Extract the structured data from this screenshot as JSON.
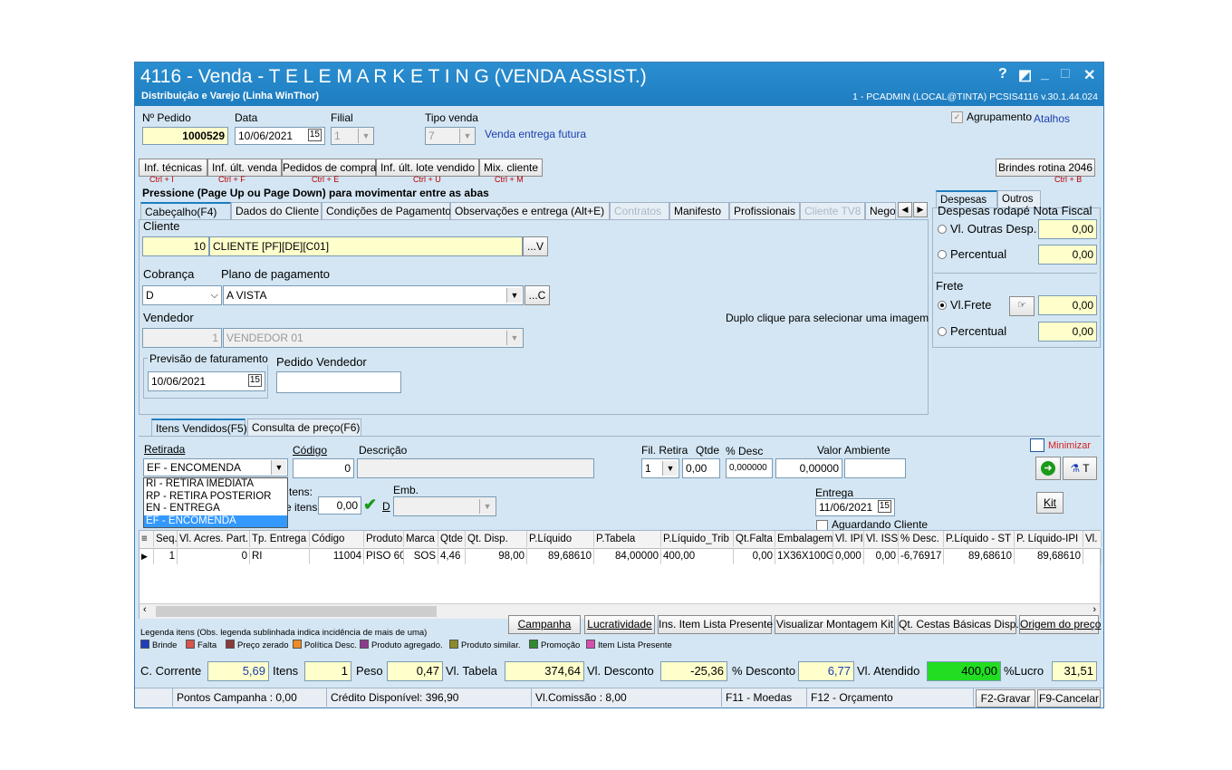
{
  "window": {
    "title": "4116 - Venda - T E L E M A R K E T I N G  (VENDA ASSIST.)",
    "subtitle": "Distribuição e Varejo (Linha WinThor)",
    "user_info": "1 - PCADMIN (LOCAL@TINTA)  PCSIS4116  v.30.1.44.024",
    "controls": {
      "help": "?",
      "restore": "◩",
      "minimize": "_",
      "maximize": "□",
      "close": "✕"
    }
  },
  "header": {
    "pedido_label": "Nº Pedido",
    "pedido_value": "1000529",
    "data_label": "Data",
    "data_value": "10/06/2021",
    "filial_label": "Filial",
    "filial_value": "1",
    "tipo_venda_label": "Tipo venda",
    "tipo_venda_value": "7",
    "tipo_venda_desc": "Venda entrega futura",
    "agrupamento_label": "Agrupamento",
    "atalhos_label": "Atalhos"
  },
  "toolbar": {
    "buttons": [
      {
        "label": "Inf. técnicas",
        "shortcut": "Ctrl + I"
      },
      {
        "label": "Inf. últ. venda",
        "shortcut": "Ctrl + F"
      },
      {
        "label": "Pedidos de compra",
        "shortcut": "Ctrl + E"
      },
      {
        "label": "Inf. últ. lote vendido",
        "shortcut": "Ctrl + U"
      },
      {
        "label": "Mix. cliente",
        "shortcut": "Ctrl + M"
      }
    ],
    "brindes": {
      "label": "Brindes rotina 2046",
      "shortcut": "Ctrl + B"
    }
  },
  "hint": "Pressione (Page Up ou Page Down) para movimentar entre as abas",
  "tabs": [
    {
      "label": "Cabeçalho(F4)"
    },
    {
      "label": "Dados do Cliente"
    },
    {
      "label": "Condições de Pagamento"
    },
    {
      "label": "Observações e entrega (Alt+E)"
    },
    {
      "label": "Contratos"
    },
    {
      "label": "Manifesto"
    },
    {
      "label": "Profissionais"
    },
    {
      "label": "Cliente TV8"
    },
    {
      "label": "Nego"
    }
  ],
  "cabecalho": {
    "cliente_label": "Cliente",
    "cliente_code": "10",
    "cliente_name": "CLIENTE [PF][DE][C01]",
    "cliente_btn": "...V",
    "cobranca_label": "Cobrança",
    "cobranca_value": "D",
    "plano_label": "Plano de pagamento",
    "plano_value": "A VISTA",
    "plano_btn": "...C",
    "vendedor_label": "Vendedor",
    "vendedor_code": "1",
    "vendedor_name": "VENDEDOR 01",
    "previsao_label": "Previsão de faturamento",
    "previsao_value": "10/06/2021",
    "pedido_vendedor_label": "Pedido Vendedor",
    "pedido_vendedor_value": "",
    "image_hint": "Duplo clique para selecionar uma imagem"
  },
  "despesas": {
    "tab1": "Despesas",
    "tab2": "Outros",
    "title": "Despesas rodapé Nota Fiscal",
    "vl_outras_label": "Vl. Outras Desp.",
    "vl_outras_value": "0,00",
    "percentual_label": "Percentual",
    "percentual_value": "0,00",
    "frete_label": "Frete",
    "vl_frete_label": "Vl.Frete",
    "vl_frete_value": "0,00",
    "frete_percentual_label": "Percentual",
    "frete_percentual_value": "0,00"
  },
  "items_tabs": [
    {
      "label": "Itens Vendidos(F5)"
    },
    {
      "label": "Consulta de preço(F6)"
    }
  ],
  "items_form": {
    "retirada_label": "Retirada",
    "retirada_value": "EF - ENCOMENDA",
    "retirada_options": [
      "RI - RETIRA IMEDIATA",
      "RP - RETIRA POSTERIOR",
      "EN - ENTREGA",
      "EF - ENCOMENDA"
    ],
    "codigo_label": "Código",
    "codigo_value": "0",
    "descricao_label": "Descrição",
    "fil_retira_label": "Fil. Retira",
    "fil_retira_value": "1",
    "qtde_label": "Qtde",
    "qtde_value": "0,00",
    "desc_label": "% Desc",
    "desc_value": "0,000000",
    "valor_label": "Valor",
    "valor_value": "0,00000",
    "ambiente_label": "Ambiente",
    "itens_label": "tens:",
    "itens2_label": "e itens:",
    "itens_value": "0,00",
    "d_label": "D",
    "emb_label": "Emb.",
    "entrega_label": "Entrega",
    "entrega_value": "11/06/2021",
    "aguardando_label": "Aguardando Cliente",
    "minimizar_label": "Minimizar",
    "t_label": "T",
    "kit_label": "Kit"
  },
  "grid": {
    "columns": [
      "Seq.",
      "Vl. Acres. Part.",
      "Tp. Entrega",
      "Código",
      "Produto",
      "Marca",
      "Qtde",
      "Qt. Disp.",
      "P.Líquido",
      "P.Tabela",
      "P.Líquido_Trib",
      "Qt.Falta",
      "Embalagem",
      "Vl. IPI",
      "Vl. ISS",
      "% Desc.",
      "P.Líquido - ST",
      "P. Líquido-IPI",
      "Vl."
    ],
    "rows": [
      [
        "1",
        "0",
        "RI",
        "11004",
        "PISO 60",
        "SOS",
        "4,46",
        "98,00",
        "89,68610",
        "84,00000",
        "400,00",
        "0,00",
        "1X36X100G",
        "0,000",
        "0,00",
        "-6,76917",
        "89,68610",
        "89,68610",
        ""
      ]
    ]
  },
  "bottom_buttons": [
    "Campanha",
    "Lucratividade",
    "Ins. Item Lista Presente",
    "Visualizar Montagem Kit",
    "Qt. Cestas Básicas Disp.",
    "Origem do preço"
  ],
  "legend": {
    "title": "Legenda itens (Obs. legenda sublinhada indica incidência de mais de uma)",
    "items": [
      {
        "label": "Brinde",
        "color": "#1f3fbf"
      },
      {
        "label": "Falta",
        "color": "#d9534f"
      },
      {
        "label": "Preço zerado",
        "color": "#8b3a3a"
      },
      {
        "label": "Política Desc.",
        "color": "#f08a24"
      },
      {
        "label": "Produto agregado.",
        "color": "#8e3b8e"
      },
      {
        "label": "Produto similar.",
        "color": "#8b8b2a"
      },
      {
        "label": "Promoção",
        "color": "#2e8b2e"
      },
      {
        "label": "Item Lista Presente",
        "color": "#d94fb0"
      }
    ]
  },
  "totals": {
    "c_corrente_label": "C. Corrente",
    "c_corrente_value": "5,69",
    "itens_label": "Itens",
    "itens_value": "1",
    "peso_label": "Peso",
    "peso_value": "0,47",
    "vl_tabela_label": "Vl. Tabela",
    "vl_tabela_value": "374,64",
    "vl_desconto_label": "Vl. Desconto",
    "vl_desconto_value": "-25,36",
    "pct_desconto_label": "% Desconto",
    "pct_desconto_value": "6,77",
    "vl_atendido_label": "Vl. Atendido",
    "vl_atendido_value": "400,00",
    "lucro_label": "%Lucro",
    "lucro_value": "31,51"
  },
  "statusbar": {
    "pontos": "Pontos Campanha : 0,00",
    "credito": "Crédito Disponível: 396,90",
    "comissao": "Vl.Comissão : 8,00",
    "f11": "F11 - Moedas",
    "f12": "F12 - Orçamento",
    "gravar": "F2-Gravar",
    "cancelar": "F9-Cancelar"
  }
}
